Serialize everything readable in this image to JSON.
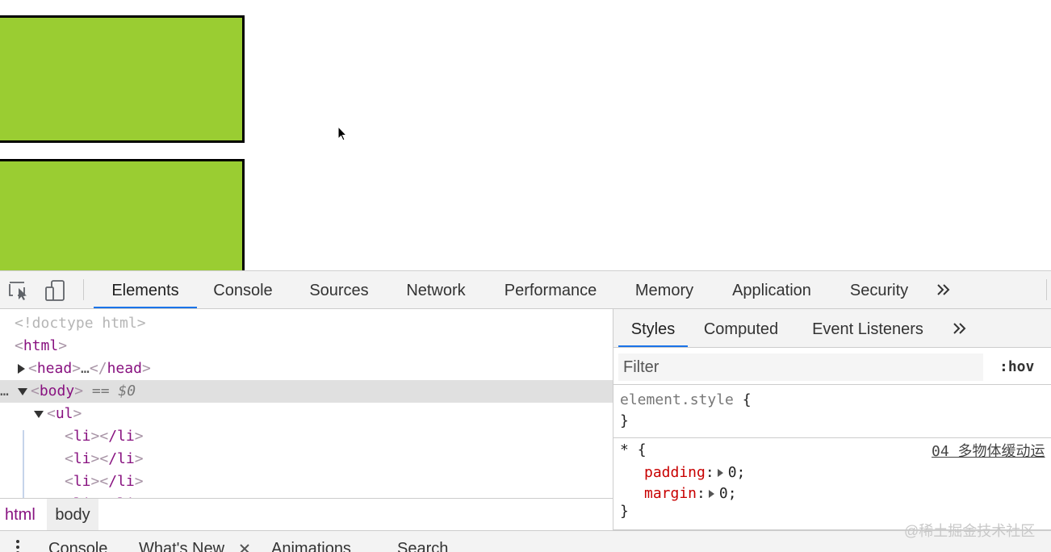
{
  "colors": {
    "box_fill": "#9acd32",
    "box_border": "#000000",
    "tab_active_underline": "#1a73e8",
    "tag_color": "#881280",
    "property_color": "#c80000"
  },
  "viewport": {
    "boxes": [
      {
        "name": "box-1"
      },
      {
        "name": "box-2"
      }
    ]
  },
  "toolbar": {
    "icons": [
      "inspect-element-icon",
      "device-toolbar-icon",
      "more-tabs-icon"
    ],
    "tabs": [
      {
        "label": "Elements",
        "active": true
      },
      {
        "label": "Console"
      },
      {
        "label": "Sources"
      },
      {
        "label": "Network"
      },
      {
        "label": "Performance"
      },
      {
        "label": "Memory"
      },
      {
        "label": "Application"
      },
      {
        "label": "Security"
      }
    ],
    "more_label": "»"
  },
  "elements": {
    "doctype": "<!doctype html>",
    "html_open": "html",
    "head_tag": "head",
    "head_ellipsis": "…",
    "body_tag": "body",
    "body_marker": "== $0",
    "ellipsis_prefix": "…",
    "ul_tag": "ul",
    "li_tag": "li",
    "li_close": "/li"
  },
  "breadcrumbs": {
    "items": [
      "html",
      "body"
    ]
  },
  "styles": {
    "tabs": [
      {
        "label": "Styles",
        "active": true
      },
      {
        "label": "Computed"
      },
      {
        "label": "Event Listeners"
      }
    ],
    "more_label": "»",
    "filter_placeholder": "Filter",
    "hov_label": ":hov",
    "element_style": {
      "selector": "element.style",
      "open": "{",
      "close": "}"
    },
    "star_rule": {
      "selector": "*",
      "open": "{",
      "close": "}",
      "source": "04 多物体缓动运",
      "properties": [
        {
          "name": "padding",
          "value": "0"
        },
        {
          "name": "margin",
          "value": "0"
        }
      ]
    }
  },
  "drawer": {
    "tabs": [
      "Console",
      "What's New",
      "Animations",
      "Search"
    ],
    "close_label": "×"
  },
  "watermark": "@稀土掘金技术社区"
}
